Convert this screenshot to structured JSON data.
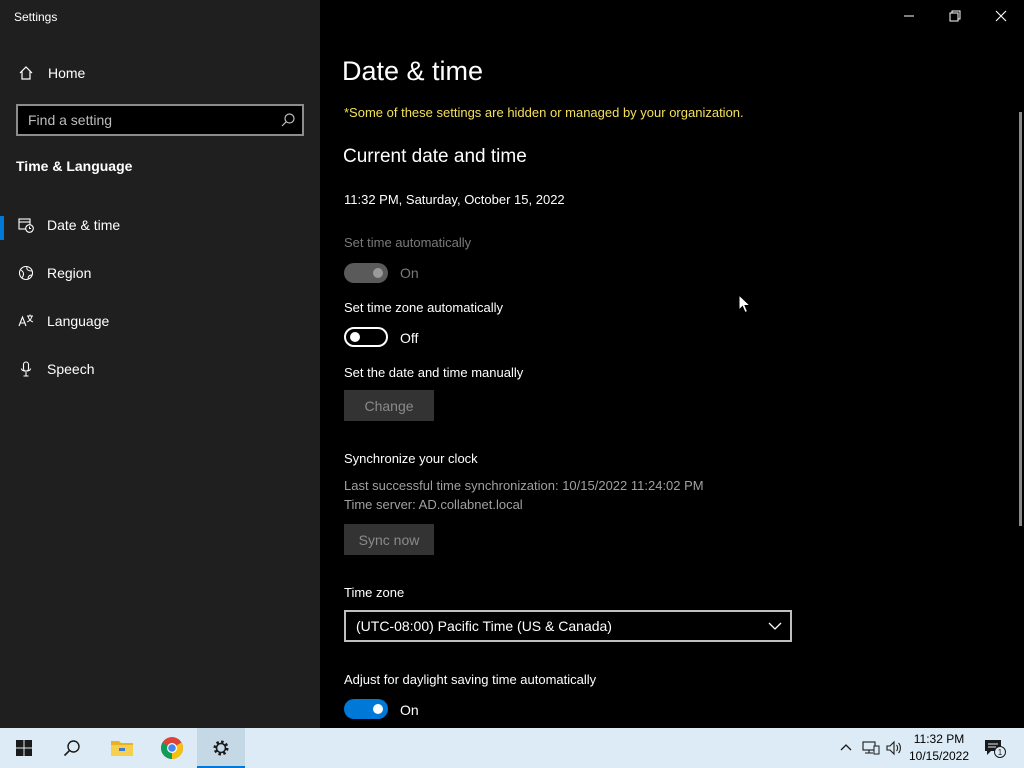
{
  "window": {
    "title": "Settings"
  },
  "sidebar": {
    "home_label": "Home",
    "search_placeholder": "Find a setting",
    "section_title": "Time & Language",
    "items": [
      {
        "label": "Date & time",
        "icon": "calendar-clock-icon",
        "active": true
      },
      {
        "label": "Region",
        "icon": "globe-icon",
        "active": false
      },
      {
        "label": "Language",
        "icon": "language-icon",
        "active": false
      },
      {
        "label": "Speech",
        "icon": "microphone-icon",
        "active": false
      }
    ]
  },
  "main": {
    "page_title": "Date & time",
    "org_notice": "*Some of these settings are hidden or managed by your organization.",
    "current_heading": "Current date and time",
    "current_datetime": "11:32 PM, Saturday, October 15, 2022",
    "set_time_auto": {
      "label": "Set time automatically",
      "state": "On",
      "enabled": false
    },
    "set_tz_auto": {
      "label": "Set time zone automatically",
      "state": "Off",
      "enabled": true
    },
    "manual": {
      "label": "Set the date and time manually",
      "button": "Change"
    },
    "sync": {
      "heading": "Synchronize your clock",
      "last_sync": "Last successful time synchronization: 10/15/2022 11:24:02 PM",
      "server": "Time server: AD.collabnet.local",
      "button": "Sync now"
    },
    "time_zone": {
      "label": "Time zone",
      "value": "(UTC-08:00) Pacific Time (US & Canada)"
    },
    "dst": {
      "label": "Adjust for daylight saving time automatically",
      "state": "On"
    }
  },
  "taskbar": {
    "clock_time": "11:32 PM",
    "clock_date": "10/15/2022",
    "notification_count": "1",
    "apps": [
      "start-icon",
      "search-icon",
      "file-explorer-icon",
      "chrome-icon",
      "settings-icon"
    ]
  },
  "colors": {
    "accent": "#0078d7",
    "notice": "#f2e05a",
    "sidebar_bg": "#1f1f1f",
    "taskbar_bg": "#dcebf5"
  }
}
